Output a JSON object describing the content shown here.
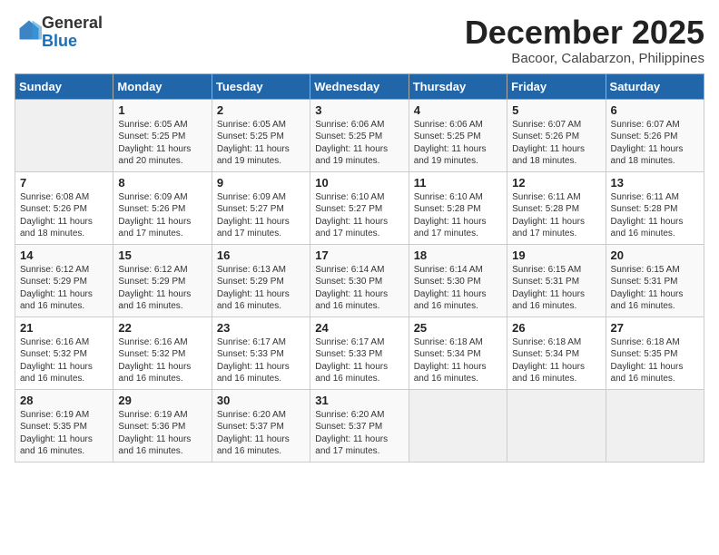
{
  "header": {
    "logo_general": "General",
    "logo_blue": "Blue",
    "month": "December 2025",
    "location": "Bacoor, Calabarzon, Philippines"
  },
  "weekdays": [
    "Sunday",
    "Monday",
    "Tuesday",
    "Wednesday",
    "Thursday",
    "Friday",
    "Saturday"
  ],
  "weeks": [
    [
      {
        "day": "",
        "sunrise": "",
        "sunset": "",
        "daylight": ""
      },
      {
        "day": "1",
        "sunrise": "Sunrise: 6:05 AM",
        "sunset": "Sunset: 5:25 PM",
        "daylight": "Daylight: 11 hours and 20 minutes."
      },
      {
        "day": "2",
        "sunrise": "Sunrise: 6:05 AM",
        "sunset": "Sunset: 5:25 PM",
        "daylight": "Daylight: 11 hours and 19 minutes."
      },
      {
        "day": "3",
        "sunrise": "Sunrise: 6:06 AM",
        "sunset": "Sunset: 5:25 PM",
        "daylight": "Daylight: 11 hours and 19 minutes."
      },
      {
        "day": "4",
        "sunrise": "Sunrise: 6:06 AM",
        "sunset": "Sunset: 5:25 PM",
        "daylight": "Daylight: 11 hours and 19 minutes."
      },
      {
        "day": "5",
        "sunrise": "Sunrise: 6:07 AM",
        "sunset": "Sunset: 5:26 PM",
        "daylight": "Daylight: 11 hours and 18 minutes."
      },
      {
        "day": "6",
        "sunrise": "Sunrise: 6:07 AM",
        "sunset": "Sunset: 5:26 PM",
        "daylight": "Daylight: 11 hours and 18 minutes."
      }
    ],
    [
      {
        "day": "7",
        "sunrise": "Sunrise: 6:08 AM",
        "sunset": "Sunset: 5:26 PM",
        "daylight": "Daylight: 11 hours and 18 minutes."
      },
      {
        "day": "8",
        "sunrise": "Sunrise: 6:09 AM",
        "sunset": "Sunset: 5:26 PM",
        "daylight": "Daylight: 11 hours and 17 minutes."
      },
      {
        "day": "9",
        "sunrise": "Sunrise: 6:09 AM",
        "sunset": "Sunset: 5:27 PM",
        "daylight": "Daylight: 11 hours and 17 minutes."
      },
      {
        "day": "10",
        "sunrise": "Sunrise: 6:10 AM",
        "sunset": "Sunset: 5:27 PM",
        "daylight": "Daylight: 11 hours and 17 minutes."
      },
      {
        "day": "11",
        "sunrise": "Sunrise: 6:10 AM",
        "sunset": "Sunset: 5:28 PM",
        "daylight": "Daylight: 11 hours and 17 minutes."
      },
      {
        "day": "12",
        "sunrise": "Sunrise: 6:11 AM",
        "sunset": "Sunset: 5:28 PM",
        "daylight": "Daylight: 11 hours and 17 minutes."
      },
      {
        "day": "13",
        "sunrise": "Sunrise: 6:11 AM",
        "sunset": "Sunset: 5:28 PM",
        "daylight": "Daylight: 11 hours and 16 minutes."
      }
    ],
    [
      {
        "day": "14",
        "sunrise": "Sunrise: 6:12 AM",
        "sunset": "Sunset: 5:29 PM",
        "daylight": "Daylight: 11 hours and 16 minutes."
      },
      {
        "day": "15",
        "sunrise": "Sunrise: 6:12 AM",
        "sunset": "Sunset: 5:29 PM",
        "daylight": "Daylight: 11 hours and 16 minutes."
      },
      {
        "day": "16",
        "sunrise": "Sunrise: 6:13 AM",
        "sunset": "Sunset: 5:29 PM",
        "daylight": "Daylight: 11 hours and 16 minutes."
      },
      {
        "day": "17",
        "sunrise": "Sunrise: 6:14 AM",
        "sunset": "Sunset: 5:30 PM",
        "daylight": "Daylight: 11 hours and 16 minutes."
      },
      {
        "day": "18",
        "sunrise": "Sunrise: 6:14 AM",
        "sunset": "Sunset: 5:30 PM",
        "daylight": "Daylight: 11 hours and 16 minutes."
      },
      {
        "day": "19",
        "sunrise": "Sunrise: 6:15 AM",
        "sunset": "Sunset: 5:31 PM",
        "daylight": "Daylight: 11 hours and 16 minutes."
      },
      {
        "day": "20",
        "sunrise": "Sunrise: 6:15 AM",
        "sunset": "Sunset: 5:31 PM",
        "daylight": "Daylight: 11 hours and 16 minutes."
      }
    ],
    [
      {
        "day": "21",
        "sunrise": "Sunrise: 6:16 AM",
        "sunset": "Sunset: 5:32 PM",
        "daylight": "Daylight: 11 hours and 16 minutes."
      },
      {
        "day": "22",
        "sunrise": "Sunrise: 6:16 AM",
        "sunset": "Sunset: 5:32 PM",
        "daylight": "Daylight: 11 hours and 16 minutes."
      },
      {
        "day": "23",
        "sunrise": "Sunrise: 6:17 AM",
        "sunset": "Sunset: 5:33 PM",
        "daylight": "Daylight: 11 hours and 16 minutes."
      },
      {
        "day": "24",
        "sunrise": "Sunrise: 6:17 AM",
        "sunset": "Sunset: 5:33 PM",
        "daylight": "Daylight: 11 hours and 16 minutes."
      },
      {
        "day": "25",
        "sunrise": "Sunrise: 6:18 AM",
        "sunset": "Sunset: 5:34 PM",
        "daylight": "Daylight: 11 hours and 16 minutes."
      },
      {
        "day": "26",
        "sunrise": "Sunrise: 6:18 AM",
        "sunset": "Sunset: 5:34 PM",
        "daylight": "Daylight: 11 hours and 16 minutes."
      },
      {
        "day": "27",
        "sunrise": "Sunrise: 6:18 AM",
        "sunset": "Sunset: 5:35 PM",
        "daylight": "Daylight: 11 hours and 16 minutes."
      }
    ],
    [
      {
        "day": "28",
        "sunrise": "Sunrise: 6:19 AM",
        "sunset": "Sunset: 5:35 PM",
        "daylight": "Daylight: 11 hours and 16 minutes."
      },
      {
        "day": "29",
        "sunrise": "Sunrise: 6:19 AM",
        "sunset": "Sunset: 5:36 PM",
        "daylight": "Daylight: 11 hours and 16 minutes."
      },
      {
        "day": "30",
        "sunrise": "Sunrise: 6:20 AM",
        "sunset": "Sunset: 5:37 PM",
        "daylight": "Daylight: 11 hours and 16 minutes."
      },
      {
        "day": "31",
        "sunrise": "Sunrise: 6:20 AM",
        "sunset": "Sunset: 5:37 PM",
        "daylight": "Daylight: 11 hours and 17 minutes."
      },
      {
        "day": "",
        "sunrise": "",
        "sunset": "",
        "daylight": ""
      },
      {
        "day": "",
        "sunrise": "",
        "sunset": "",
        "daylight": ""
      },
      {
        "day": "",
        "sunrise": "",
        "sunset": "",
        "daylight": ""
      }
    ]
  ]
}
